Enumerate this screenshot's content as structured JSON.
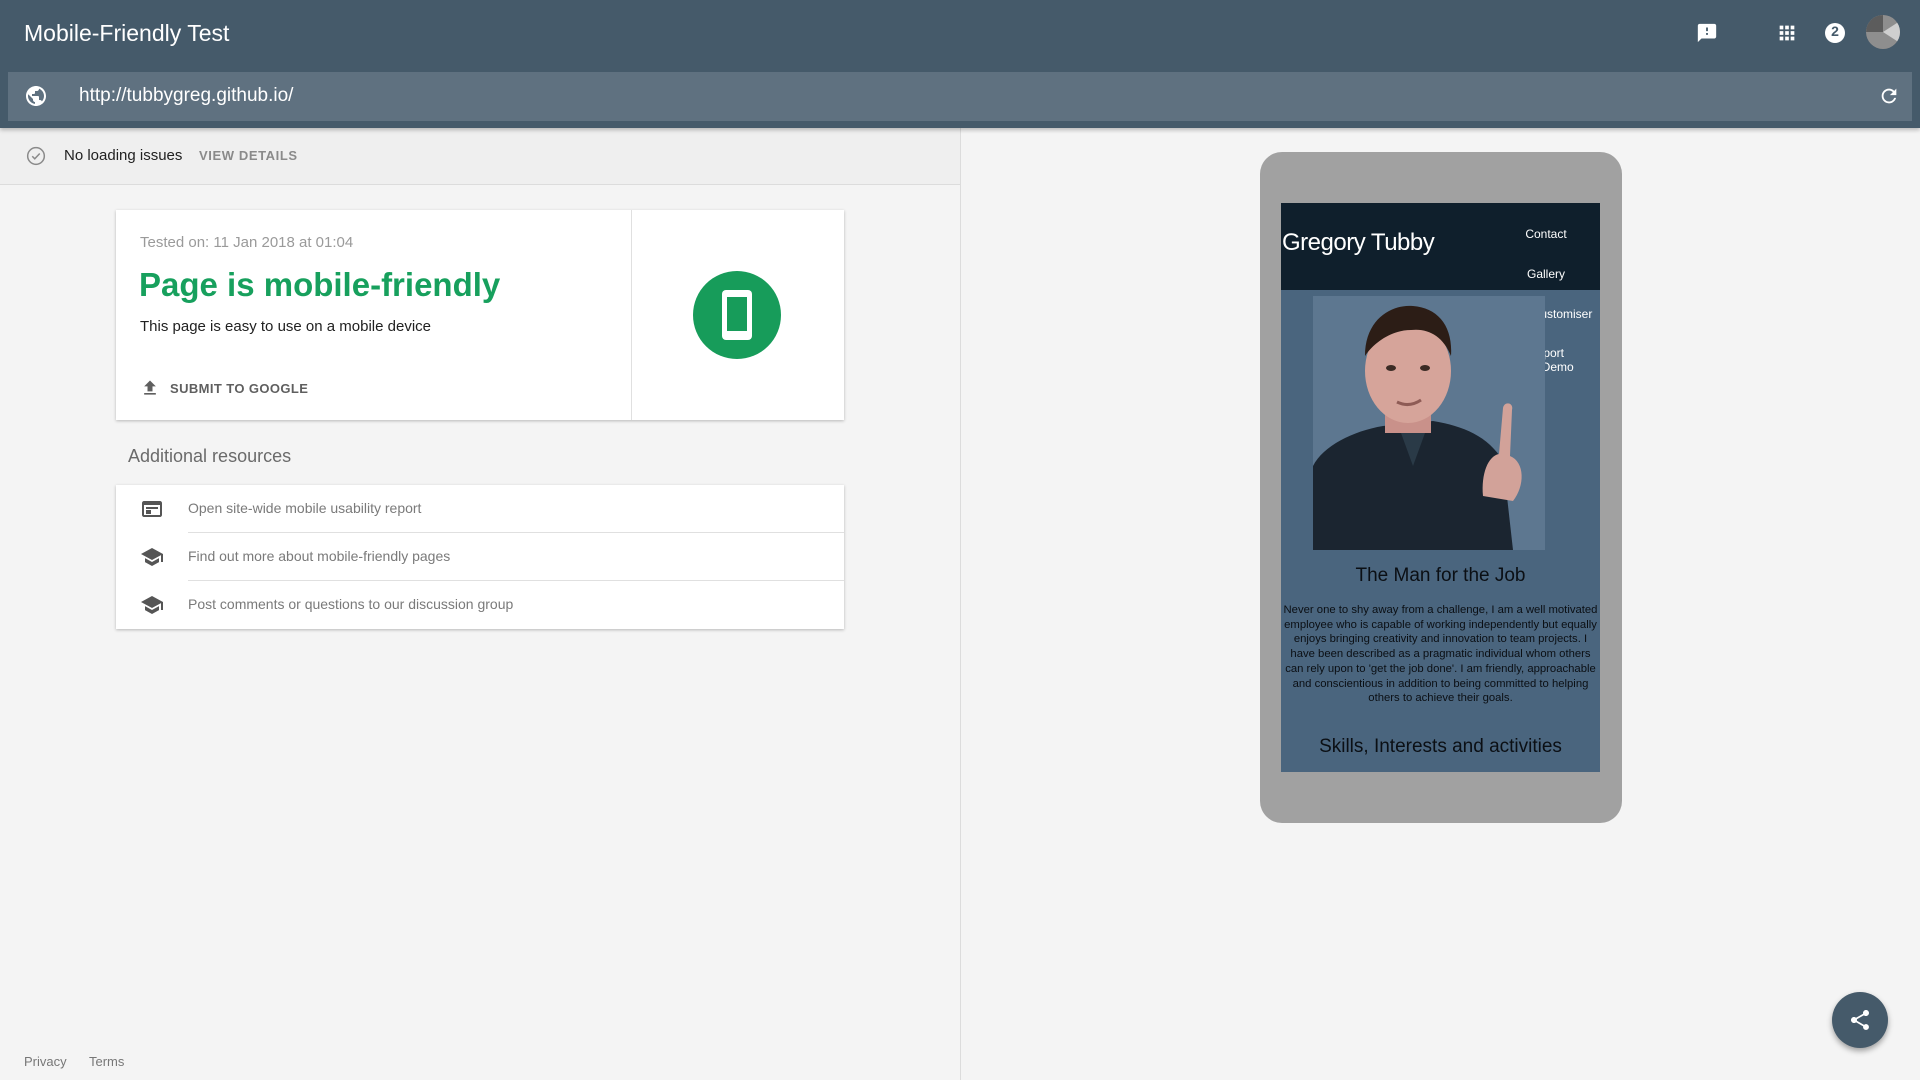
{
  "header": {
    "title": "Mobile-Friendly Test",
    "help_badge": "2",
    "icons": [
      "feedback-icon",
      "apps-icon",
      "help-icon"
    ]
  },
  "url_bar": {
    "url": "http://tubbygreg.github.io/"
  },
  "status": {
    "text": "No loading issues",
    "link": "VIEW DETAILS"
  },
  "result": {
    "tested_on": "Tested on: 11 Jan 2018 at 01:04",
    "verdict": "Page is mobile-friendly",
    "subtitle": "This page is easy to use on a mobile device",
    "submit_label": "SUBMIT TO GOOGLE"
  },
  "resources": {
    "title": "Additional resources",
    "items": [
      {
        "label": "Open site-wide mobile usability report",
        "icon": "report-icon"
      },
      {
        "label": "Find out more about mobile-friendly pages",
        "icon": "school-icon"
      },
      {
        "label": "Post comments or questions to our discussion group",
        "icon": "school-icon"
      }
    ]
  },
  "footer": {
    "privacy": "Privacy",
    "terms": "Terms"
  },
  "preview": {
    "site_name": "Gregory Tubby",
    "nav": [
      "Contact",
      "Gallery",
      "Mask Customiser",
      "Report and Demo"
    ],
    "heading": "The Man for the Job",
    "paragraph": "Never one to shy away from a challenge, I am a well motivated employee who is capable of working independently but equally enjoys bringing creativity and innovation to team projects. I have been described as a pragmatic individual whom others can rely upon to 'get the job done'. I am friendly, approachable and conscientious in addition to being committed to helping others to achieve their goals.",
    "subheading": "Skills, Interests and activities"
  },
  "colors": {
    "header_bg": "#455a6a",
    "url_bar_bg": "#5f7180",
    "success_green": "#17a05d",
    "preview_bg": "#4a657e"
  }
}
